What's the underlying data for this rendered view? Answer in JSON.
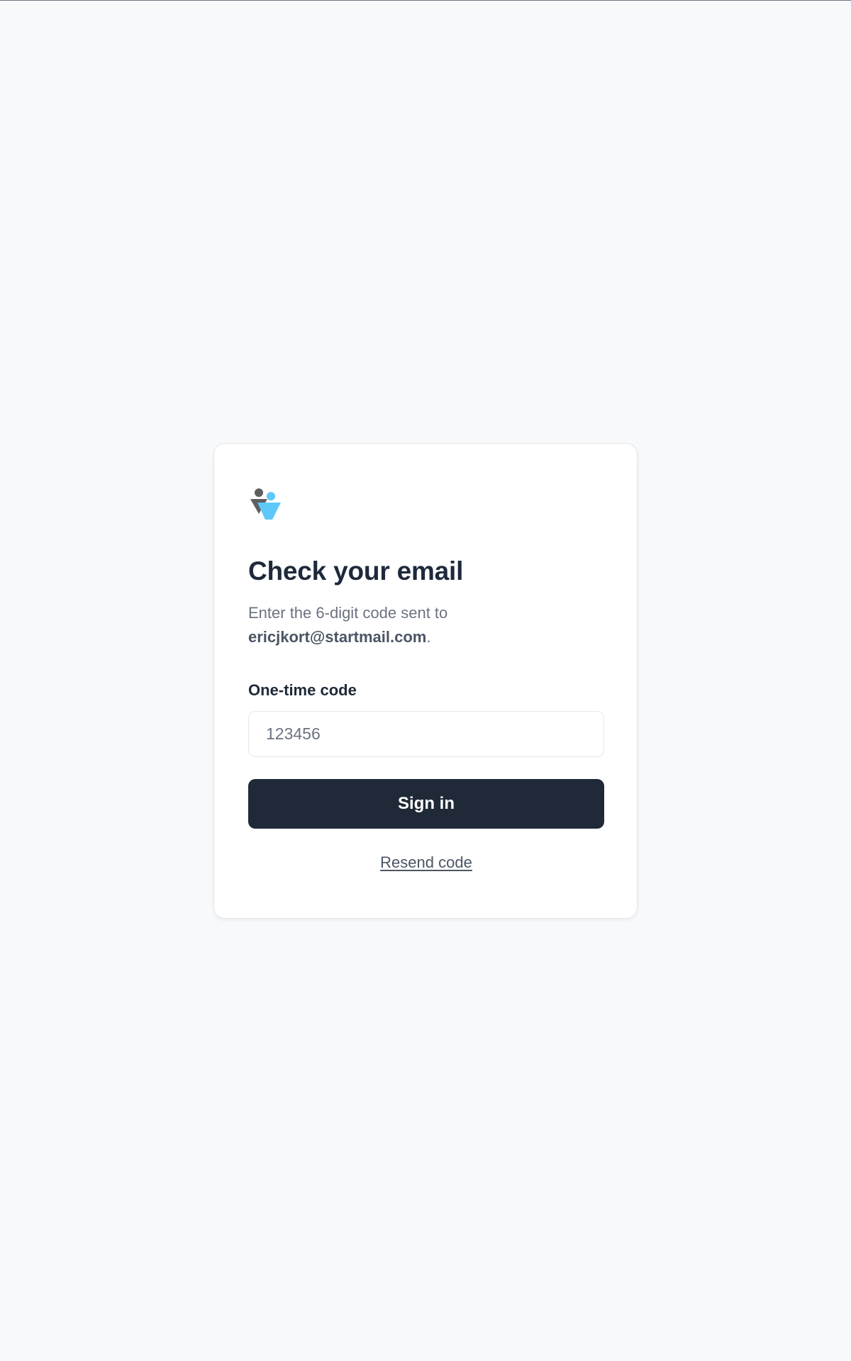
{
  "card": {
    "logo_icon": "people-icon",
    "title": "Check your email",
    "subtitle_prefix": "Enter the 6-digit code sent to",
    "email": "ericjkort@startmail.com",
    "subtitle_suffix": "."
  },
  "form": {
    "code_label": "One-time code",
    "code_value": "",
    "code_placeholder": "123456",
    "signin_label": "Sign in",
    "resend_label": "Resend code"
  },
  "colors": {
    "page_bg": "#f8f9fb",
    "card_bg": "#ffffff",
    "primary_button": "#1f2937",
    "logo_dark": "#5f5f5f",
    "logo_blue": "#5ec8f8"
  }
}
